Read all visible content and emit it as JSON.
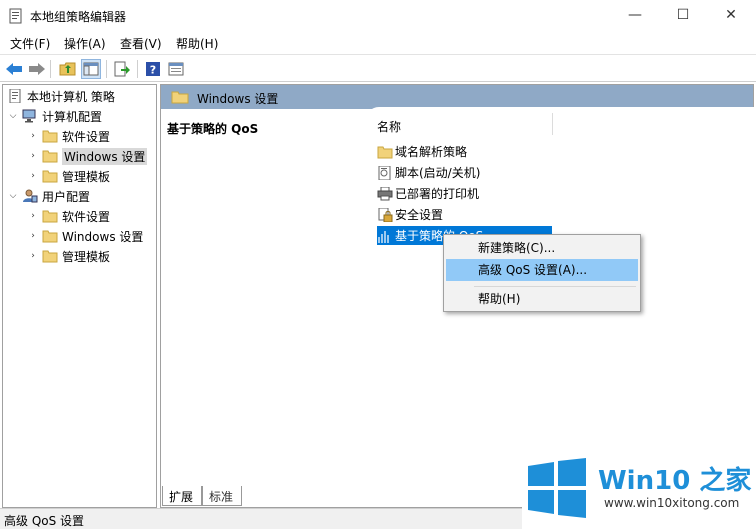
{
  "window": {
    "title": "本地组策略编辑器",
    "minimize": "—",
    "maximize": "☐",
    "close": "✕"
  },
  "menu": [
    {
      "label": "文件(F)"
    },
    {
      "label": "操作(A)"
    },
    {
      "label": "查看(V)"
    },
    {
      "label": "帮助(H)"
    }
  ],
  "toolbar": {
    "icons": [
      "back-arrow-icon",
      "forward-arrow-icon",
      "up-folder-icon",
      "show-hide-tree-icon",
      "export-list-icon",
      "help-icon",
      "properties-view-icon"
    ]
  },
  "tree": {
    "root": "本地计算机 策略",
    "computer_config": "计算机配置",
    "computer_children": [
      "软件设置",
      "Windows 设置",
      "管理模板"
    ],
    "user_config": "用户配置",
    "user_children": [
      "软件设置",
      "Windows 设置",
      "管理模板"
    ]
  },
  "right": {
    "header": "Windows 设置",
    "left_title": "基于策略的 QoS",
    "column_name": "名称",
    "items": [
      "域名解析策略",
      "脚本(启动/关机)",
      "已部署的打印机",
      "安全设置",
      "基于策略的 QoS"
    ]
  },
  "context_menu": {
    "items": [
      "新建策略(C)...",
      "高级 QoS 设置(A)...",
      "帮助(H)"
    ]
  },
  "tabs": [
    "扩展",
    "标准"
  ],
  "status": "高级 QoS 设置",
  "watermark": {
    "brand": "Win10 之家",
    "url": "www.win10xitong.com"
  },
  "colors": {
    "header_bg": "#8fa9c6",
    "selection": "#0078d7",
    "menu_hover": "#91c9f7",
    "brand_blue": "#1e8fd8"
  }
}
